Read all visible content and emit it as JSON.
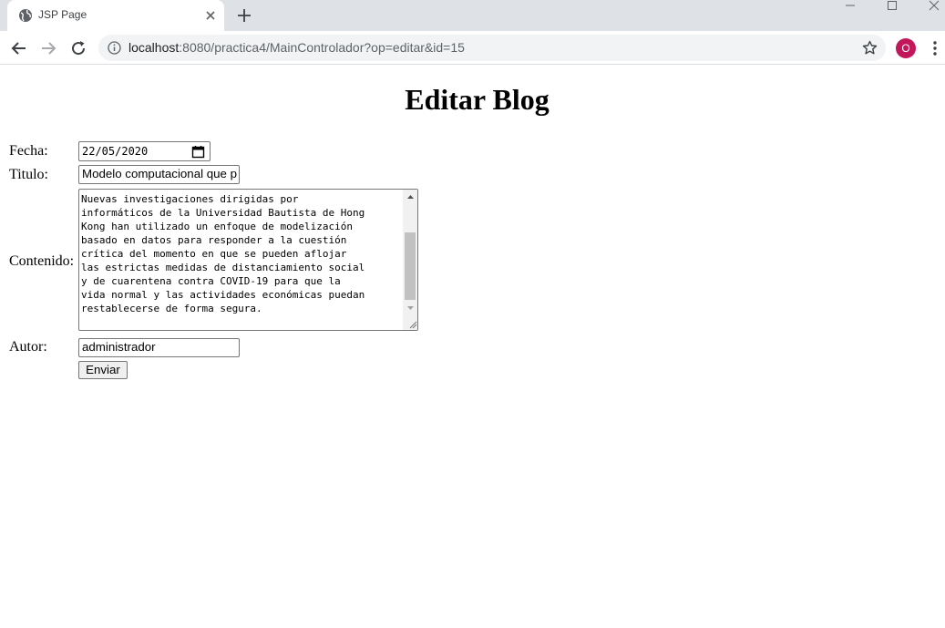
{
  "browser": {
    "tab_title": "JSP Page",
    "url_host": "localhost",
    "url_rest": ":8080/practica4/MainControlador?op=editar&id=15",
    "avatar_letter": "O",
    "avatar_color": "#c2185b"
  },
  "page": {
    "title": "Editar Blog"
  },
  "form": {
    "fecha_label": "Fecha:",
    "fecha_value": "22/05/2020",
    "titulo_label": "Titulo:",
    "titulo_value": "Modelo computacional que p",
    "contenido_label": "Contenido:",
    "contenido_value": "Nuevas investigaciones dirigidas por\ninformáticos de la Universidad Bautista de Hong\nKong han utilizado un enfoque de modelización\nbasado en datos para responder a la cuestión\ncrítica del momento en que se pueden aflojar\nlas estrictas medidas de distanciamiento social\ny de cuarentena contra COVID-19 para que la\nvida normal y las actividades económicas puedan\nrestablecerse de forma segura.",
    "autor_label": "Autor:",
    "autor_value": "administrador",
    "submit_label": "Enviar"
  }
}
